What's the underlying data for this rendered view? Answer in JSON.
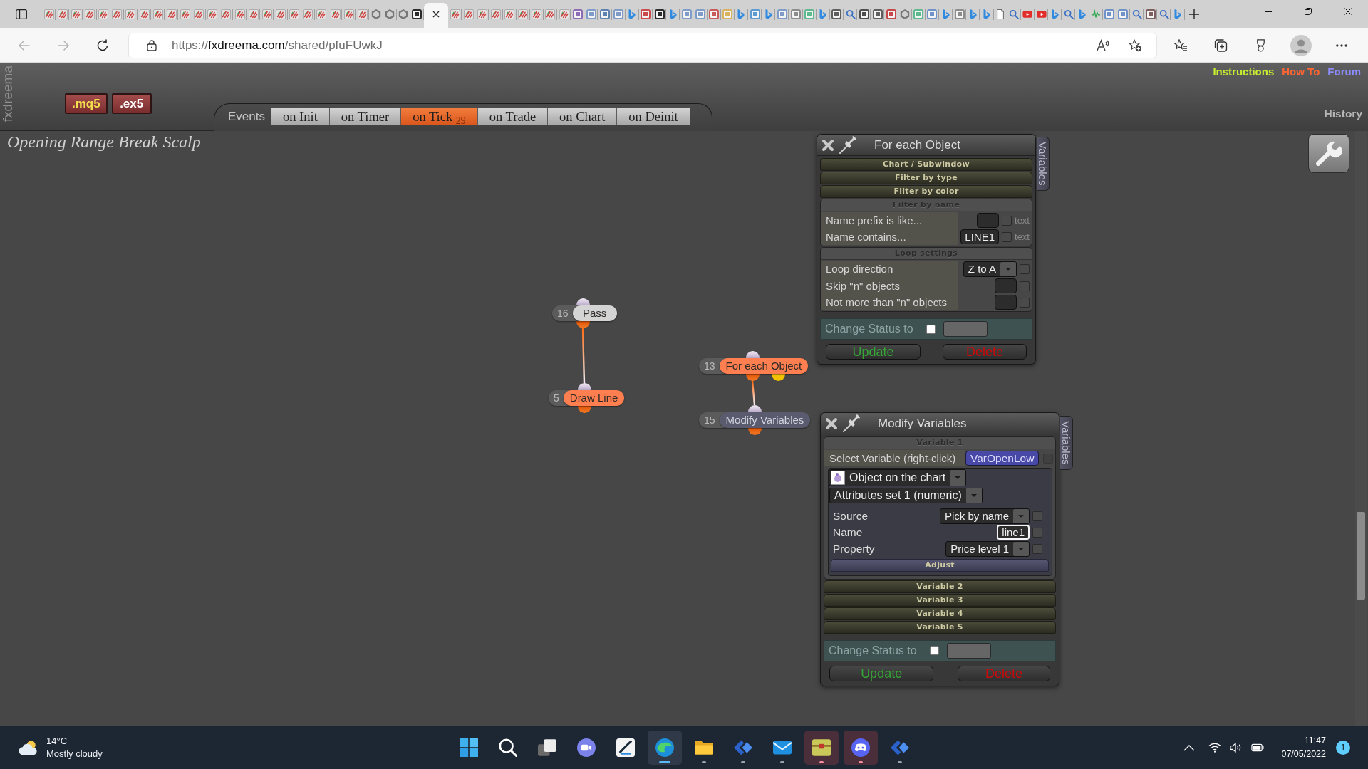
{
  "browser": {
    "tabs": [
      {
        "selected": false,
        "kind": "stripes"
      },
      {
        "selected": false,
        "kind": "stripes"
      },
      {
        "selected": false,
        "kind": "stripes"
      },
      {
        "selected": false,
        "kind": "stripes"
      },
      {
        "selected": false,
        "kind": "stripes"
      },
      {
        "selected": false,
        "kind": "stripes"
      },
      {
        "selected": false,
        "kind": "stripes"
      },
      {
        "selected": false,
        "kind": "stripes"
      },
      {
        "selected": false,
        "kind": "stripes"
      },
      {
        "selected": false,
        "kind": "stripes"
      },
      {
        "selected": false,
        "kind": "stripes"
      },
      {
        "selected": false,
        "kind": "stripes"
      },
      {
        "selected": false,
        "kind": "stripes"
      },
      {
        "selected": false,
        "kind": "stripes"
      },
      {
        "selected": false,
        "kind": "stripes"
      },
      {
        "selected": false,
        "kind": "stripes"
      },
      {
        "selected": false,
        "kind": "stripes"
      },
      {
        "selected": false,
        "kind": "stripes"
      },
      {
        "selected": false,
        "kind": "stripes"
      },
      {
        "selected": false,
        "kind": "stripes"
      },
      {
        "selected": false,
        "kind": "stripes"
      },
      {
        "selected": false,
        "kind": "stripes"
      },
      {
        "selected": false,
        "kind": "stripes"
      },
      {
        "selected": false,
        "kind": "stripes"
      },
      {
        "selected": false,
        "kind": "ring"
      },
      {
        "selected": false,
        "kind": "ring"
      },
      {
        "selected": false,
        "kind": "ring"
      },
      {
        "selected": false,
        "kind": "tile",
        "color": "#2b2b2b"
      },
      {
        "selected": true
      },
      {
        "selected": false,
        "kind": "stripes"
      },
      {
        "selected": false,
        "kind": "stripes"
      },
      {
        "selected": false,
        "kind": "stripes"
      },
      {
        "selected": false,
        "kind": "stripes"
      },
      {
        "selected": false,
        "kind": "stripes"
      },
      {
        "selected": false,
        "kind": "stripes"
      },
      {
        "selected": false,
        "kind": "stripes"
      },
      {
        "selected": false,
        "kind": "stripes"
      },
      {
        "selected": false,
        "kind": "stripes"
      },
      {
        "selected": false,
        "kind": "tile",
        "color": "#8e6bb5"
      },
      {
        "selected": false,
        "kind": "tile",
        "color": "#7f9cc8"
      },
      {
        "selected": false,
        "kind": "tile",
        "color": "#5d82b0"
      },
      {
        "selected": false,
        "kind": "tile",
        "color": "#7f9cc8"
      },
      {
        "selected": false,
        "kind": "curve"
      },
      {
        "selected": false,
        "kind": "tile",
        "color": "#c94b4b"
      },
      {
        "selected": false,
        "kind": "tile",
        "color": "#2b2b2b"
      },
      {
        "selected": false,
        "kind": "curve"
      },
      {
        "selected": false,
        "kind": "tile",
        "color": "#7f9cc8"
      },
      {
        "selected": false,
        "kind": "tile",
        "color": "#7f9cc8"
      },
      {
        "selected": false,
        "kind": "tile",
        "color": "#c85a5a"
      },
      {
        "selected": false,
        "kind": "tile",
        "color": "#d9b25f"
      },
      {
        "selected": false,
        "kind": "curve"
      },
      {
        "selected": false,
        "kind": "tile",
        "color": "#5c9bd1"
      },
      {
        "selected": false,
        "kind": "curve"
      },
      {
        "selected": false,
        "kind": "tile",
        "color": "#7f9cc8"
      },
      {
        "selected": false,
        "kind": "tile",
        "color": "#8c8c8c"
      },
      {
        "selected": false,
        "kind": "tile",
        "color": "#5fb98e"
      },
      {
        "selected": false,
        "kind": "curve"
      },
      {
        "selected": false,
        "kind": "tile",
        "color": "#5e5e5e"
      },
      {
        "selected": false,
        "kind": "search"
      },
      {
        "selected": false,
        "kind": "tile",
        "color": "#4d4d4d"
      },
      {
        "selected": false,
        "kind": "tile",
        "color": "#5e5e5e"
      },
      {
        "selected": false,
        "kind": "tile",
        "color": "#c64848"
      },
      {
        "selected": false,
        "kind": "ring"
      },
      {
        "selected": false,
        "kind": "tile",
        "color": "#5fb98e"
      },
      {
        "selected": false,
        "kind": "tile",
        "color": "#6f93c9"
      },
      {
        "selected": false,
        "kind": "curve"
      },
      {
        "selected": false,
        "kind": "tile",
        "color": "#8c8c8c"
      },
      {
        "selected": false,
        "kind": "curve"
      },
      {
        "selected": false,
        "kind": "curve"
      },
      {
        "selected": false,
        "kind": "page"
      },
      {
        "selected": false,
        "kind": "search"
      },
      {
        "selected": false,
        "kind": "play"
      },
      {
        "selected": false,
        "kind": "play"
      },
      {
        "selected": false,
        "kind": "curve"
      },
      {
        "selected": false,
        "kind": "search"
      },
      {
        "selected": false,
        "kind": "curve"
      },
      {
        "selected": false,
        "kind": "wave"
      },
      {
        "selected": false,
        "kind": "tile",
        "color": "#6f93c9"
      },
      {
        "selected": false,
        "kind": "tile",
        "color": "#6f93c9"
      },
      {
        "selected": false,
        "kind": "search"
      },
      {
        "selected": false,
        "kind": "tile",
        "color": "#7d5f5f"
      },
      {
        "selected": false,
        "kind": "search"
      },
      {
        "selected": false,
        "kind": "curve"
      }
    ],
    "back": {
      "disabled": true
    },
    "forward": {
      "disabled": true
    },
    "url": {
      "scheme": "https://",
      "host": "fxdreema.com",
      "path": "/shared/pfuFUwkJ"
    }
  },
  "header": {
    "side_logo": "fxdreema",
    "export_buttons": [
      {
        "label": ".mq5",
        "color": "#f4e04d"
      },
      {
        "label": ".ex5",
        "color": "#ffffff"
      }
    ],
    "events": {
      "label": "Events",
      "tabs": [
        {
          "label": "on Init",
          "selected": false
        },
        {
          "label": "on Timer",
          "selected": false
        },
        {
          "label": "on Tick",
          "count": "29",
          "selected": true
        },
        {
          "label": "on Trade",
          "selected": false
        },
        {
          "label": "on Chart",
          "selected": false
        },
        {
          "label": "on Deinit",
          "selected": false
        }
      ]
    },
    "links": [
      {
        "label": "Instructions",
        "color": "#c6ef2f"
      },
      {
        "label": "How To",
        "color": "#ff6633"
      },
      {
        "label": "Forum",
        "color": "#8c8cff"
      }
    ],
    "history": "History"
  },
  "project_title": "Opening Range Break Scalp",
  "canvas": {
    "blocks": [
      {
        "number": "16",
        "label": "Pass",
        "color": "#d4d4d4",
        "second_output": false,
        "children": [
          {
            "number": "5",
            "label": "Draw Line",
            "color": "#ff7f50",
            "second_output": false
          }
        ]
      },
      {
        "number": "13",
        "label": "For each Object",
        "color": "#ff7f50",
        "second_output": true,
        "children": [
          {
            "number": "15",
            "label": "Modify Variables",
            "color": "#5a5b6e",
            "second_output": false
          }
        ]
      }
    ]
  },
  "panels": [
    {
      "title": "For each Object",
      "side_tab": "Variables",
      "sections": [
        {
          "title": "Chart / Subwindow",
          "expanded": false
        },
        {
          "title": "Filter by type",
          "expanded": false
        },
        {
          "title": "Filter by color",
          "expanded": false
        },
        {
          "title": "Filter by name",
          "expanded": true,
          "rows": [
            {
              "kind": "text",
              "label": "Name prefix is like...",
              "option": "text",
              "checked": false,
              "focused": false
            },
            {
              "kind": "text",
              "label": "Name contains...",
              "value": "LINE1",
              "option": "text",
              "checked": false,
              "focused": false
            }
          ]
        },
        {
          "title": "Loop settings",
          "expanded": true,
          "rows": [
            {
              "kind": "select",
              "label": "Loop direction",
              "value": "Z to A",
              "checked": false
            },
            {
              "kind": "text",
              "label": "Skip \"n\" objects",
              "checked": false,
              "focused": false
            },
            {
              "kind": "text",
              "label": "Not more than \"n\" objects",
              "checked": false,
              "focused": false
            }
          ]
        }
      ],
      "status": {
        "label": "Change Status to",
        "checked": false
      },
      "buttons": [
        {
          "label": "Update",
          "kind": "update"
        },
        {
          "label": "Delete",
          "kind": "delete"
        }
      ]
    },
    {
      "title": "Modify Variables",
      "side_tab": "Variables",
      "sections": [
        {
          "title": "Variable 1",
          "expanded": true,
          "rows": [
            {
              "kind": "picker",
              "label": "Select Variable (right-click)",
              "value": "VarOpenLow",
              "checked": false
            }
          ],
          "group": {
            "dropdowns": [
              {
                "value": "Object on the chart",
                "icon": true
              },
              {
                "value": "Attributes set 1 (numeric)",
                "icon": false
              }
            ],
            "rows": [
              {
                "kind": "select",
                "label": "Source",
                "value": "Pick by name",
                "checked": false
              },
              {
                "kind": "text",
                "label": "Name",
                "value": "line1",
                "checked": false,
                "focused": true
              },
              {
                "kind": "select",
                "label": "Property",
                "value": "Price level 1",
                "checked": false
              }
            ],
            "sections": [
              {
                "title": "Adjust",
                "expanded": false
              }
            ]
          }
        },
        {
          "title": "Variable 2",
          "expanded": false
        },
        {
          "title": "Variable 3",
          "expanded": false
        },
        {
          "title": "Variable 4",
          "expanded": false
        },
        {
          "title": "Variable 5",
          "expanded": false
        }
      ],
      "status": {
        "label": "Change Status to",
        "checked": false
      },
      "buttons": [
        {
          "label": "Update",
          "kind": "update"
        },
        {
          "label": "Delete",
          "kind": "delete"
        }
      ]
    }
  ],
  "taskbar": {
    "weather": {
      "temperature": "14°C",
      "condition": "Mostly cloudy"
    },
    "apps": [
      {
        "kind": "start",
        "selected": false,
        "running": false,
        "attention": false
      },
      {
        "kind": "search",
        "selected": false,
        "running": false,
        "attention": false
      },
      {
        "kind": "tasks",
        "selected": false,
        "running": false,
        "attention": false
      },
      {
        "kind": "chat",
        "selected": false,
        "running": false,
        "attention": false
      },
      {
        "kind": "swoosh",
        "selected": false,
        "running": false,
        "attention": false
      },
      {
        "kind": "swirl",
        "selected": true,
        "running": true,
        "attention": false
      },
      {
        "kind": "folder",
        "selected": false,
        "running": true,
        "attention": false
      },
      {
        "kind": "chevrons",
        "selected": false,
        "running": true,
        "attention": false
      },
      {
        "kind": "envelope",
        "selected": false,
        "running": true,
        "attention": false
      },
      {
        "kind": "package",
        "selected": false,
        "running": true,
        "attention": true
      },
      {
        "kind": "controller",
        "selected": false,
        "running": true,
        "attention": true
      },
      {
        "kind": "chevrons",
        "selected": false,
        "running": true,
        "attention": false
      }
    ],
    "tray": {
      "time": "11:47",
      "date": "07/05/2022",
      "notifications": "1"
    }
  }
}
